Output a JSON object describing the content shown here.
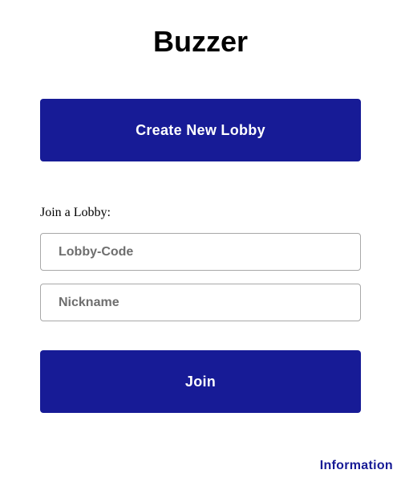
{
  "app": {
    "title": "Buzzer"
  },
  "create": {
    "button_label": "Create New Lobby"
  },
  "join": {
    "section_label": "Join a Lobby:",
    "lobby_code": {
      "value": "",
      "placeholder": "Lobby-Code"
    },
    "nickname": {
      "value": "",
      "placeholder": "Nickname"
    },
    "button_label": "Join"
  },
  "footer": {
    "info_link": "Information"
  },
  "colors": {
    "primary": "#171b96",
    "background": "#ffffff",
    "field_border": "#a8a8a8",
    "placeholder": "#6e6e6e"
  }
}
